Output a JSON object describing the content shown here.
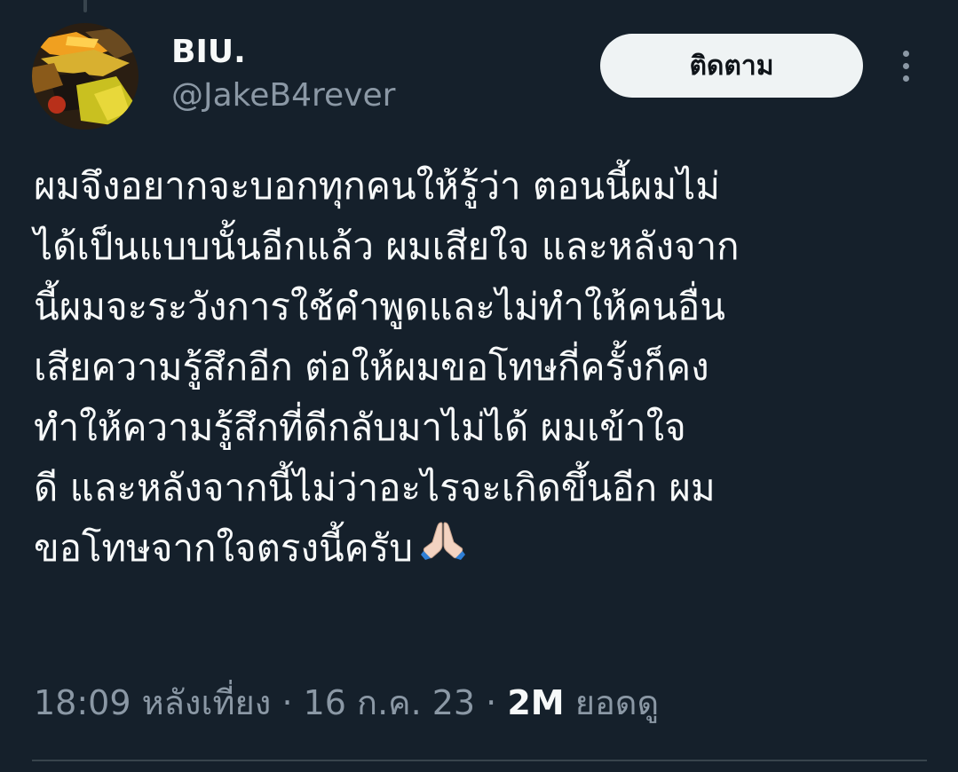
{
  "author": {
    "display_name": "BIU.",
    "handle": "@JakeB4rever"
  },
  "header": {
    "follow_label": "ติดตาม",
    "more_icon": "more-vertical-icon"
  },
  "tweet": {
    "lines": [
      "ผมจึงอยากจะบอกทุกคนให้รู้ว่า ตอนนี้ผมไม่",
      "ได้เป็นแบบนั้นอีกแล้ว ผมเสียใจ และหลังจาก",
      "นี้ผมจะระวังการใช้คำพูดและไม่ทำให้คนอื่น",
      "เสียความรู้สึกอีก ต่อให้ผมขอโทษกี่ครั้งก็คง",
      "ทำให้ความรู้สึกที่ดีกลับมาไม่ได้ ผมเข้าใจ",
      "ดี และหลังจากนี้ไม่ว่าอะไรจะเกิดขึ้นอีก ผม",
      "ขอโทษจากใจตรงนี้ครับ"
    ],
    "emoji_icon": "folded-hands-icon"
  },
  "meta": {
    "time": "18:09 หลังเที่ยง",
    "date": "16 ก.ค. 23",
    "separator": "·",
    "views_count": "2M",
    "views_label": "ยอดดู"
  },
  "colors": {
    "background": "#15202b",
    "primary_text": "#f7f9f9",
    "secondary_text": "#8b98a5",
    "button_bg": "#eff3f4",
    "divider": "#38444d"
  }
}
